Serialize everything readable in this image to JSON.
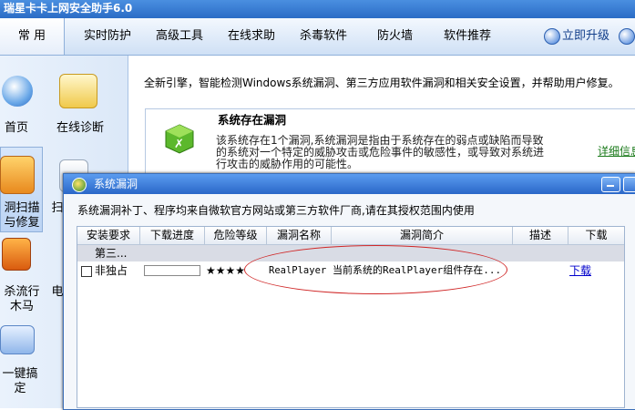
{
  "app": {
    "title": "瑞星卡卡上网安全助手6.0"
  },
  "toolbar": {
    "tabs": [
      "常 用",
      "实时防护",
      "高级工具",
      "在线求助",
      "杀毒软件",
      "防火墙",
      "软件推荐"
    ],
    "upgrade": "立即升级"
  },
  "sidebar": {
    "items": [
      "首页",
      "在线诊断",
      "洞扫描与修复",
      "扫",
      "杀流行木马",
      "电",
      "一键搞定"
    ]
  },
  "content": {
    "intro": "全新引擎，智能检测Windows系统漏洞、第三方应用软件漏洞和相关安全设置，并帮助用户修复。",
    "card": {
      "title": "系统存在漏洞",
      "desc": "该系统存在1个漏洞,系统漏洞是指由于系统存在的弱点或缺陷而导致的系统对一个特定的威胁攻击或危险事件的敏感性，或导致对系统进行攻击的威胁作用的可能性。",
      "detail_link": "详细信息"
    }
  },
  "dialog": {
    "title": "系统漏洞",
    "note": "系统漏洞补丁、程序均来自微软官方网站或第三方软件厂商,请在其授权范围内使用",
    "columns": [
      "安装要求",
      "下载进度",
      "危险等级",
      "漏洞名称",
      "漏洞简介",
      "描述",
      "下载"
    ],
    "group_label": "第三...",
    "row": {
      "requirement": "非独占",
      "progress": 0,
      "danger_stars": 4,
      "danger_text": "★★★★",
      "name": "RealPlayer",
      "summary": "当前系统的RealPlayer组件存在...",
      "desc": "",
      "download": "下载"
    }
  },
  "colors": {
    "titlebar": "#2b6cc6",
    "link_green": "#1a7a1a",
    "link_blue": "#0000cc",
    "highlight_ellipse": "#d02828"
  }
}
